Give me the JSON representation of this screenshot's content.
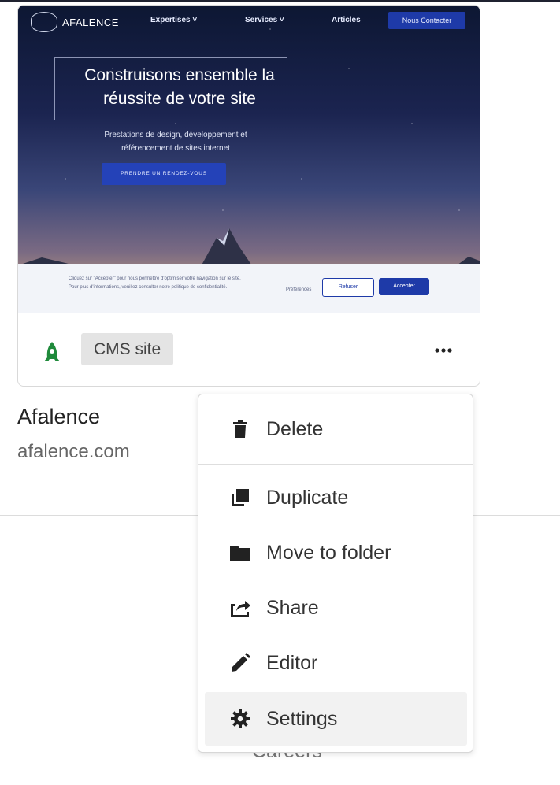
{
  "site_preview": {
    "logo_text": "AFALENCE",
    "nav": [
      "Expertises",
      "Services",
      "Articles"
    ],
    "nav_chevrons": [
      true,
      true,
      false
    ],
    "cta": "Nous Contacter",
    "hero_title": "Construisons ensemble la réussite de votre site",
    "hero_subtitle": "Prestations de design, développement et référencement de sites internet",
    "hero_button": "PRENDRE UN RENDEZ-VOUS",
    "cookie_text_1": "Cliquez sur \"Accepter\" pour nous permettre d'optimiser votre navigation sur le site.",
    "cookie_text_2": "Pour plus d'informations, veuillez consulter notre politique de confidentialité.",
    "cookie_preferences": "Préférences",
    "cookie_refuse": "Refuser",
    "cookie_accept": "Accepter"
  },
  "card": {
    "type_badge": "CMS site",
    "site_icon": "rocket-icon",
    "more_icon": "more-horizontal-icon"
  },
  "site": {
    "name": "Afalence",
    "domain": "afalence.com"
  },
  "background": {
    "partial_text": "Careers"
  },
  "menu": {
    "items": [
      {
        "label": "Delete",
        "icon": "trash-icon"
      },
      {
        "label": "Duplicate",
        "icon": "duplicate-icon"
      },
      {
        "label": "Move to folder",
        "icon": "folder-icon"
      },
      {
        "label": "Share",
        "icon": "share-icon"
      },
      {
        "label": "Editor",
        "icon": "pencil-icon"
      },
      {
        "label": "Settings",
        "icon": "gear-icon"
      }
    ],
    "active_item": "Settings"
  },
  "colors": {
    "brand_green": "#1f8a3b",
    "site_blue": "#1e3aa8"
  }
}
